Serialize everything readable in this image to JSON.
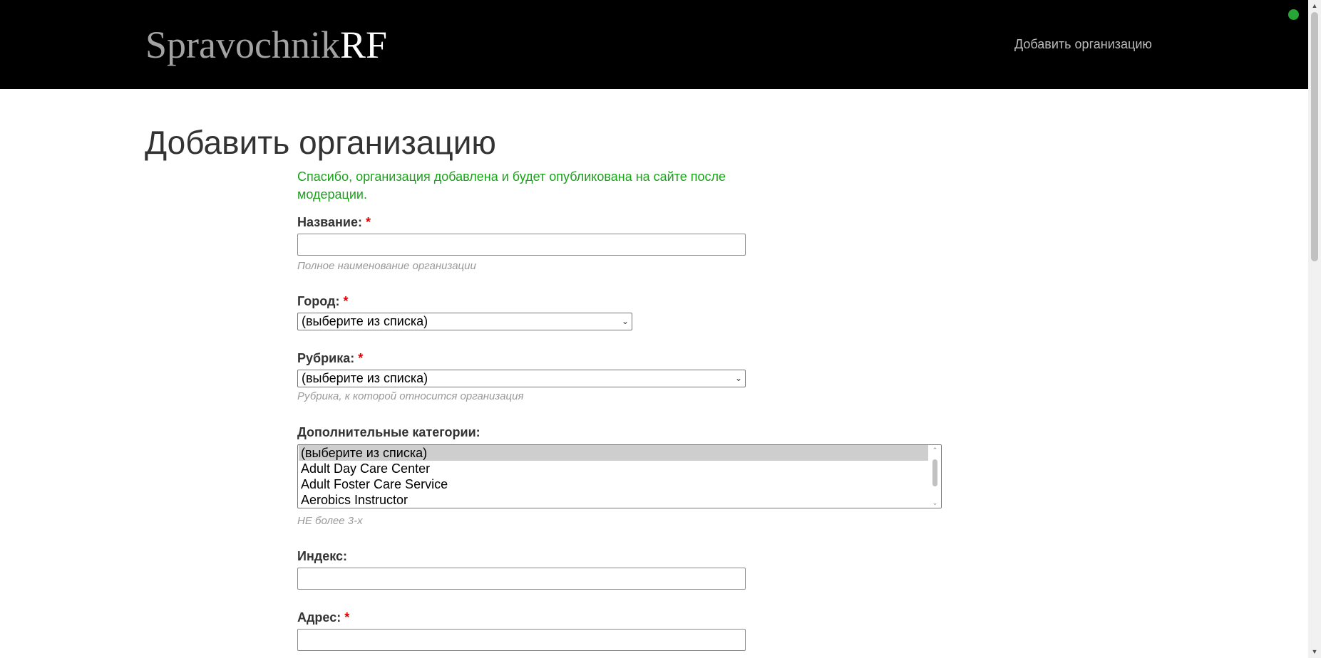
{
  "header": {
    "logo_main": "Spravochnik",
    "logo_accent": "RF",
    "nav_link": "Добавить организацию",
    "background_color": "#000000"
  },
  "page": {
    "title": "Добавить организацию",
    "success_message": "Спасибо, организация добавлена и будет опубликована на сайте после модерации.",
    "success_color": "#19a319"
  },
  "form": {
    "required_mark": "*",
    "name": {
      "label": "Название:",
      "value": "",
      "hint": "Полное наименование организации"
    },
    "city": {
      "label": "Город:",
      "selected": "(выберите из списка)"
    },
    "rubric": {
      "label": "Рубрика:",
      "selected": "(выберите из списка)",
      "hint": "Рубрика, к которой относится организация"
    },
    "extra_categories": {
      "label": "Дополнительные категории:",
      "options": [
        "(выберите из списка)",
        "Adult Day Care Center",
        "Adult Foster Care Service",
        "Aerobics Instructor"
      ],
      "selected_index": 0,
      "hint": "НЕ более 3-х"
    },
    "postal_index": {
      "label": "Индекс:",
      "value": ""
    },
    "address": {
      "label": "Адрес:",
      "value": ""
    }
  },
  "icons": {
    "status_dot": "status-dot-icon",
    "dropdown_arrow": "chevron-down-icon"
  }
}
